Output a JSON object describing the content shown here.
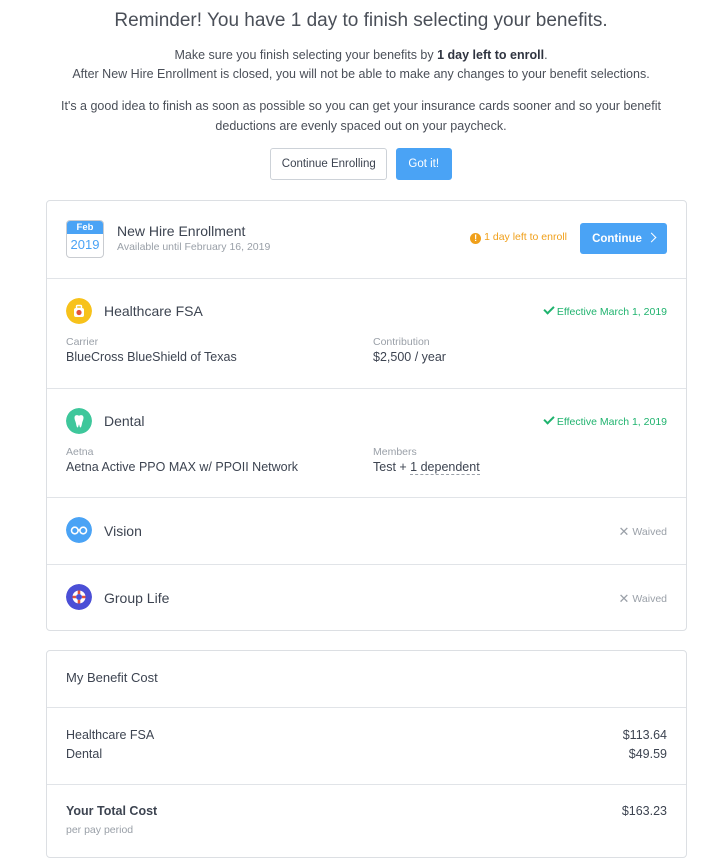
{
  "banner": {
    "title": "Reminder! You have 1 day to finish selecting your benefits.",
    "line1_prefix": "Make sure you finish selecting your benefits by ",
    "line1_bold": "1 day left to enroll",
    "line1_suffix": ".",
    "line2": "After New Hire Enrollment is closed, you will not be able to make any changes to your benefit selections.",
    "line3": "It's a good idea to finish as soon as possible so you can get your insurance cards sooner and so your benefit",
    "line4": "deductions are evenly spaced out on your paycheck.",
    "continue_enrolling_label": "Continue Enrolling",
    "got_it_label": "Got it!"
  },
  "enrollment": {
    "calendar_month": "Feb",
    "calendar_year": "2019",
    "title": "New Hire Enrollment",
    "subtitle": "Available until February 16, 2019",
    "warning": "1 day left to enroll",
    "continue_label": "Continue"
  },
  "benefits": {
    "healthcare_fsa": {
      "title": "Healthcare FSA",
      "status": "Effective March 1, 2019",
      "field1_label": "Carrier",
      "field1_value": "BlueCross BlueShield of Texas",
      "field2_label": "Contribution",
      "field2_value": "$2,500 / year",
      "icon_color": "#f7c21b"
    },
    "dental": {
      "title": "Dental",
      "status": "Effective March 1, 2019",
      "field1_label": "Aetna",
      "field1_value": "Aetna Active PPO MAX w/ PPOII Network",
      "field2_label": "Members",
      "field2_value_prefix": "Test + ",
      "field2_value_link": "1 dependent",
      "icon_color": "#3ec79b"
    },
    "vision": {
      "title": "Vision",
      "status": "Waived",
      "icon_color": "#4aa3f5"
    },
    "group_life": {
      "title": "Group Life",
      "status": "Waived",
      "icon_color": "#4b4fd6"
    }
  },
  "cost": {
    "title": "My Benefit Cost",
    "items": [
      {
        "label": "Healthcare FSA",
        "amount": "$113.64"
      },
      {
        "label": "Dental",
        "amount": "$49.59"
      }
    ],
    "total_label": "Your Total Cost",
    "total_sub": "per pay period",
    "total_amount": "$163.23"
  },
  "colors": {
    "accent": "#4aa3f5",
    "warning": "#f0a01b",
    "success": "#1fb36e"
  }
}
